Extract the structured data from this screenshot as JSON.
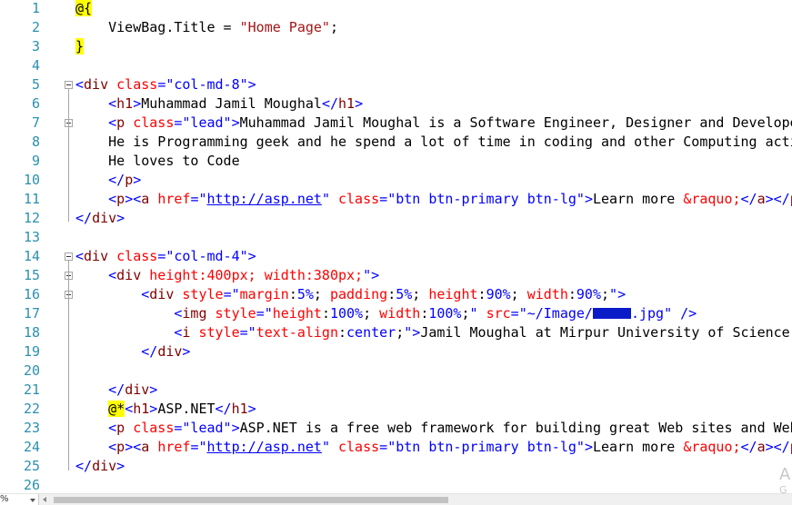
{
  "editor": {
    "lines": [
      {
        "n": "1",
        "fold": false,
        "tokens": [
          {
            "c": "t-razor",
            "t": "@{"
          }
        ]
      },
      {
        "n": "2",
        "fold": false,
        "tokens": [
          {
            "c": "t-cs",
            "t": "    ViewBag.Title = "
          },
          {
            "c": "t-csstr",
            "t": "\"Home Page\""
          },
          {
            "c": "t-cs",
            "t": ";"
          }
        ]
      },
      {
        "n": "3",
        "fold": false,
        "tokens": [
          {
            "c": "t-razor",
            "t": "}"
          }
        ]
      },
      {
        "n": "4",
        "fold": false,
        "tokens": []
      },
      {
        "n": "5",
        "fold": true,
        "tokens": [
          {
            "c": "t-tag",
            "t": "<"
          },
          {
            "c": "t-el",
            "t": "div"
          },
          {
            "c": "t-txt",
            "t": " "
          },
          {
            "c": "t-attr",
            "t": "class"
          },
          {
            "c": "t-tag",
            "t": "="
          },
          {
            "c": "t-str",
            "t": "\"col-md-8\""
          },
          {
            "c": "t-tag",
            "t": ">"
          }
        ]
      },
      {
        "n": "6",
        "fold": false,
        "tokens": [
          {
            "c": "t-txt",
            "t": "    "
          },
          {
            "c": "t-tag",
            "t": "<"
          },
          {
            "c": "t-el",
            "t": "h1"
          },
          {
            "c": "t-tag",
            "t": ">"
          },
          {
            "c": "t-text",
            "t": "Muhammad Jamil Moughal"
          },
          {
            "c": "t-tag",
            "t": "</"
          },
          {
            "c": "t-el",
            "t": "h1"
          },
          {
            "c": "t-tag",
            "t": ">"
          }
        ]
      },
      {
        "n": "7",
        "fold": true,
        "tokens": [
          {
            "c": "t-txt",
            "t": "    "
          },
          {
            "c": "t-tag",
            "t": "<"
          },
          {
            "c": "t-el",
            "t": "p"
          },
          {
            "c": "t-txt",
            "t": " "
          },
          {
            "c": "t-attr",
            "t": "class"
          },
          {
            "c": "t-tag",
            "t": "="
          },
          {
            "c": "t-str",
            "t": "\"lead\""
          },
          {
            "c": "t-tag",
            "t": ">"
          },
          {
            "c": "t-text",
            "t": "Muhammad Jamil Moughal is a Software Engineer, Designer and Develope"
          }
        ]
      },
      {
        "n": "8",
        "fold": false,
        "tokens": [
          {
            "c": "t-text",
            "t": "    He is Programming geek and he spend a lot of time in coding and other Computing acti"
          }
        ]
      },
      {
        "n": "9",
        "fold": false,
        "tokens": [
          {
            "c": "t-text",
            "t": "    He loves to Code"
          }
        ]
      },
      {
        "n": "10",
        "fold": false,
        "tokens": [
          {
            "c": "t-txt",
            "t": "    "
          },
          {
            "c": "t-tag",
            "t": "</"
          },
          {
            "c": "t-el",
            "t": "p"
          },
          {
            "c": "t-tag",
            "t": ">"
          }
        ]
      },
      {
        "n": "11",
        "fold": false,
        "tokens": [
          {
            "c": "t-txt",
            "t": "    "
          },
          {
            "c": "t-tag",
            "t": "<"
          },
          {
            "c": "t-el",
            "t": "p"
          },
          {
            "c": "t-tag",
            "t": "><"
          },
          {
            "c": "t-el",
            "t": "a"
          },
          {
            "c": "t-txt",
            "t": " "
          },
          {
            "c": "t-attr",
            "t": "href"
          },
          {
            "c": "t-tag",
            "t": "="
          },
          {
            "c": "t-str",
            "t": "\""
          },
          {
            "c": "t-url",
            "t": "http://asp.net"
          },
          {
            "c": "t-str",
            "t": "\""
          },
          {
            "c": "t-txt",
            "t": " "
          },
          {
            "c": "t-attr",
            "t": "class"
          },
          {
            "c": "t-tag",
            "t": "="
          },
          {
            "c": "t-str",
            "t": "\"btn btn-primary btn-lg\""
          },
          {
            "c": "t-tag",
            "t": ">"
          },
          {
            "c": "t-text",
            "t": "Learn more "
          },
          {
            "c": "t-ent",
            "t": "&raquo;"
          },
          {
            "c": "t-tag",
            "t": "</"
          },
          {
            "c": "t-el",
            "t": "a"
          },
          {
            "c": "t-tag",
            "t": "></"
          },
          {
            "c": "t-el",
            "t": "p"
          }
        ]
      },
      {
        "n": "12",
        "fold": false,
        "tokens": [
          {
            "c": "t-tag",
            "t": "</"
          },
          {
            "c": "t-el",
            "t": "div"
          },
          {
            "c": "t-tag",
            "t": ">"
          }
        ]
      },
      {
        "n": "13",
        "fold": false,
        "tokens": []
      },
      {
        "n": "14",
        "fold": true,
        "tokens": [
          {
            "c": "t-tag",
            "t": "<"
          },
          {
            "c": "t-el",
            "t": "div"
          },
          {
            "c": "t-txt",
            "t": " "
          },
          {
            "c": "t-attr",
            "t": "class"
          },
          {
            "c": "t-tag",
            "t": "="
          },
          {
            "c": "t-str",
            "t": "\"col-md-4\""
          },
          {
            "c": "t-tag",
            "t": ">"
          }
        ]
      },
      {
        "n": "15",
        "fold": true,
        "tokens": [
          {
            "c": "t-txt",
            "t": "    "
          },
          {
            "c": "t-tag",
            "t": "<"
          },
          {
            "c": "t-el",
            "t": "div"
          },
          {
            "c": "t-txt",
            "t": " "
          },
          {
            "c": "t-attr",
            "t": "height:400px; width:380px;"
          },
          {
            "c": "t-str",
            "t": "\""
          },
          {
            "c": "t-tag",
            "t": ">"
          }
        ]
      },
      {
        "n": "16",
        "fold": true,
        "tokens": [
          {
            "c": "t-txt",
            "t": "        "
          },
          {
            "c": "t-tag",
            "t": "<"
          },
          {
            "c": "t-el",
            "t": "div"
          },
          {
            "c": "t-txt",
            "t": " "
          },
          {
            "c": "t-attr",
            "t": "style"
          },
          {
            "c": "t-tag",
            "t": "="
          },
          {
            "c": "t-str",
            "t": "\""
          },
          {
            "c": "t-prop",
            "t": "margin"
          },
          {
            "c": "t-txt",
            "t": ":"
          },
          {
            "c": "t-val",
            "t": "5%"
          },
          {
            "c": "t-txt",
            "t": "; "
          },
          {
            "c": "t-prop",
            "t": "padding"
          },
          {
            "c": "t-txt",
            "t": ":"
          },
          {
            "c": "t-val",
            "t": "5%"
          },
          {
            "c": "t-txt",
            "t": "; "
          },
          {
            "c": "t-prop",
            "t": "height"
          },
          {
            "c": "t-txt",
            "t": ":"
          },
          {
            "c": "t-val",
            "t": "90%"
          },
          {
            "c": "t-txt",
            "t": "; "
          },
          {
            "c": "t-prop",
            "t": "width"
          },
          {
            "c": "t-txt",
            "t": ":"
          },
          {
            "c": "t-val",
            "t": "90%"
          },
          {
            "c": "t-txt",
            "t": ";"
          },
          {
            "c": "t-str",
            "t": "\""
          },
          {
            "c": "t-tag",
            "t": ">"
          }
        ]
      },
      {
        "n": "17",
        "fold": false,
        "tokens": [
          {
            "c": "t-txt",
            "t": "            "
          },
          {
            "c": "t-tag",
            "t": "<"
          },
          {
            "c": "t-el",
            "t": "img"
          },
          {
            "c": "t-txt",
            "t": " "
          },
          {
            "c": "t-attr",
            "t": "style"
          },
          {
            "c": "t-tag",
            "t": "="
          },
          {
            "c": "t-str",
            "t": "\""
          },
          {
            "c": "t-prop",
            "t": "height"
          },
          {
            "c": "t-txt",
            "t": ":"
          },
          {
            "c": "t-val",
            "t": "100%"
          },
          {
            "c": "t-txt",
            "t": "; "
          },
          {
            "c": "t-prop",
            "t": "width"
          },
          {
            "c": "t-txt",
            "t": ":"
          },
          {
            "c": "t-val",
            "t": "100%"
          },
          {
            "c": "t-txt",
            "t": ";"
          },
          {
            "c": "t-str",
            "t": "\""
          },
          {
            "c": "t-txt",
            "t": " "
          },
          {
            "c": "t-attr",
            "t": "src"
          },
          {
            "c": "t-tag",
            "t": "="
          },
          {
            "c": "t-str",
            "t": "\"~/Image/"
          },
          {
            "c": "redact",
            "t": ""
          },
          {
            "c": "t-str",
            "t": ".jpg\""
          },
          {
            "c": "t-txt",
            "t": " "
          },
          {
            "c": "t-tag",
            "t": "/>"
          }
        ]
      },
      {
        "n": "18",
        "fold": false,
        "tokens": [
          {
            "c": "t-txt",
            "t": "            "
          },
          {
            "c": "t-tag",
            "t": "<"
          },
          {
            "c": "t-el",
            "t": "i"
          },
          {
            "c": "t-txt",
            "t": " "
          },
          {
            "c": "t-attr",
            "t": "style"
          },
          {
            "c": "t-tag",
            "t": "="
          },
          {
            "c": "t-str",
            "t": "\""
          },
          {
            "c": "t-prop",
            "t": "text-align"
          },
          {
            "c": "t-txt",
            "t": ":"
          },
          {
            "c": "t-val",
            "t": "center"
          },
          {
            "c": "t-txt",
            "t": ";"
          },
          {
            "c": "t-str",
            "t": "\""
          },
          {
            "c": "t-tag",
            "t": ">"
          },
          {
            "c": "t-text",
            "t": "Jamil Moughal at Mirpur University of Science"
          }
        ]
      },
      {
        "n": "19",
        "fold": false,
        "tokens": [
          {
            "c": "t-txt",
            "t": "        "
          },
          {
            "c": "t-tag",
            "t": "</"
          },
          {
            "c": "t-el",
            "t": "div"
          },
          {
            "c": "t-tag",
            "t": ">"
          }
        ]
      },
      {
        "n": "20",
        "fold": false,
        "tokens": []
      },
      {
        "n": "21",
        "fold": false,
        "tokens": [
          {
            "c": "t-txt",
            "t": "    "
          },
          {
            "c": "t-tag",
            "t": "</"
          },
          {
            "c": "t-el",
            "t": "div"
          },
          {
            "c": "t-tag",
            "t": ">"
          }
        ]
      },
      {
        "n": "22",
        "fold": false,
        "tokens": [
          {
            "c": "t-txt",
            "t": "    "
          },
          {
            "c": "t-razor",
            "t": "@*"
          },
          {
            "c": "t-tag",
            "t": "<"
          },
          {
            "c": "t-el",
            "t": "h1"
          },
          {
            "c": "t-tag",
            "t": ">"
          },
          {
            "c": "t-text",
            "t": "ASP.NET"
          },
          {
            "c": "t-tag",
            "t": "</"
          },
          {
            "c": "t-el",
            "t": "h1"
          },
          {
            "c": "t-tag",
            "t": ">"
          }
        ]
      },
      {
        "n": "23",
        "fold": false,
        "tokens": [
          {
            "c": "t-txt",
            "t": "    "
          },
          {
            "c": "t-tag",
            "t": "<"
          },
          {
            "c": "t-el",
            "t": "p"
          },
          {
            "c": "t-txt",
            "t": " "
          },
          {
            "c": "t-attr",
            "t": "class"
          },
          {
            "c": "t-tag",
            "t": "="
          },
          {
            "c": "t-str",
            "t": "\"lead\""
          },
          {
            "c": "t-tag",
            "t": ">"
          },
          {
            "c": "t-text",
            "t": "ASP.NET is a free web framework for building great Web sites and Web"
          }
        ]
      },
      {
        "n": "24",
        "fold": false,
        "tokens": [
          {
            "c": "t-txt",
            "t": "    "
          },
          {
            "c": "t-tag",
            "t": "<"
          },
          {
            "c": "t-el",
            "t": "p"
          },
          {
            "c": "t-tag",
            "t": "><"
          },
          {
            "c": "t-el",
            "t": "a"
          },
          {
            "c": "t-txt",
            "t": " "
          },
          {
            "c": "t-attr",
            "t": "href"
          },
          {
            "c": "t-tag",
            "t": "="
          },
          {
            "c": "t-str",
            "t": "\""
          },
          {
            "c": "t-url",
            "t": "http://asp.net"
          },
          {
            "c": "t-str",
            "t": "\""
          },
          {
            "c": "t-txt",
            "t": " "
          },
          {
            "c": "t-attr",
            "t": "class"
          },
          {
            "c": "t-tag",
            "t": "="
          },
          {
            "c": "t-str",
            "t": "\"btn btn-primary btn-lg\""
          },
          {
            "c": "t-tag",
            "t": ">"
          },
          {
            "c": "t-text",
            "t": "Learn more "
          },
          {
            "c": "t-ent",
            "t": "&raquo;"
          },
          {
            "c": "t-tag",
            "t": "</"
          },
          {
            "c": "t-el",
            "t": "a"
          },
          {
            "c": "t-tag",
            "t": "></"
          },
          {
            "c": "t-el",
            "t": "p"
          }
        ]
      },
      {
        "n": "25",
        "fold": false,
        "tokens": [
          {
            "c": "t-tag",
            "t": "</"
          },
          {
            "c": "t-el",
            "t": "div"
          },
          {
            "c": "t-tag",
            "t": ">"
          }
        ]
      },
      {
        "n": "26",
        "fold": false,
        "tokens": []
      }
    ]
  },
  "statusbar": {
    "zoom": "%"
  },
  "watermark": {
    "big": "A",
    "small": "G"
  }
}
